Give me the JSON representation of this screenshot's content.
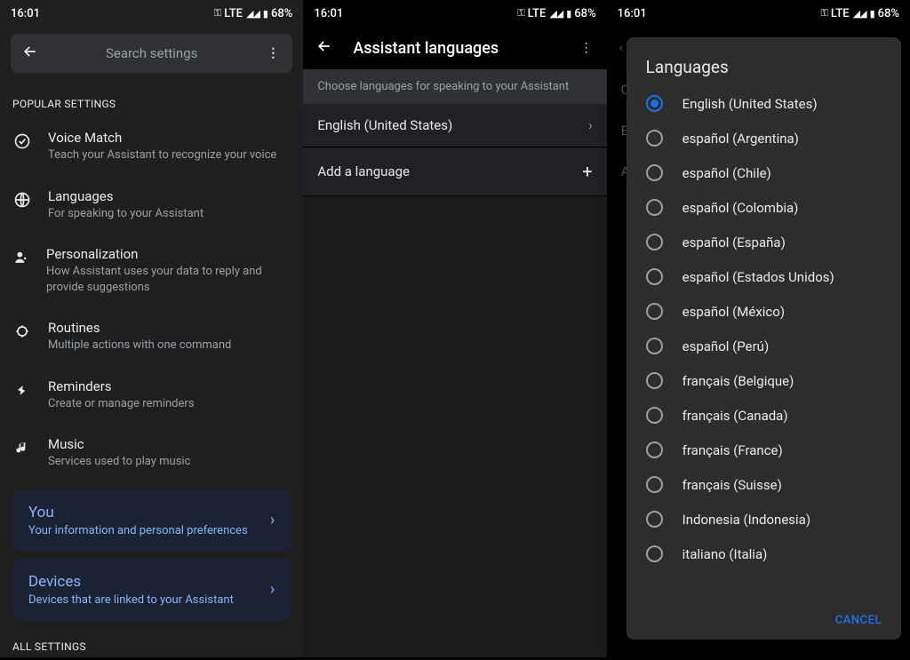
{
  "status": {
    "time": "16:01",
    "network": "LTE",
    "battery": "68%"
  },
  "screen1": {
    "search_placeholder": "Search settings",
    "section_popular": "POPULAR SETTINGS",
    "section_all": "ALL SETTINGS",
    "items": [
      {
        "title": "Voice Match",
        "sub": "Teach your Assistant to recognize your voice"
      },
      {
        "title": "Languages",
        "sub": "For speaking to your Assistant"
      },
      {
        "title": "Personalization",
        "sub": "How Assistant uses your data to reply and provide suggestions"
      },
      {
        "title": "Routines",
        "sub": "Multiple actions with one command"
      },
      {
        "title": "Reminders",
        "sub": "Create or manage reminders"
      },
      {
        "title": "Music",
        "sub": "Services used to play music"
      }
    ],
    "cards": [
      {
        "title": "You",
        "sub": "Your information and personal preferences"
      },
      {
        "title": "Devices",
        "sub": "Devices that are linked to your Assistant"
      }
    ]
  },
  "screen2": {
    "title": "Assistant languages",
    "info": "Choose languages for speaking to your Assistant",
    "primary_lang": "English (United States)",
    "add_lang": "Add a language"
  },
  "screen3": {
    "dim_c": "C",
    "dim_e": "E",
    "dim_a": "A",
    "dialog_title": "Languages",
    "cancel": "CANCEL",
    "langs": [
      "English (United States)",
      "español (Argentina)",
      "español (Chile)",
      "español (Colombia)",
      "español (España)",
      "español (Estados Unidos)",
      "español (México)",
      "español (Perú)",
      "français (Belgique)",
      "français (Canada)",
      "français (France)",
      "français (Suisse)",
      "Indonesia (Indonesia)",
      "italiano (Italia)"
    ]
  }
}
